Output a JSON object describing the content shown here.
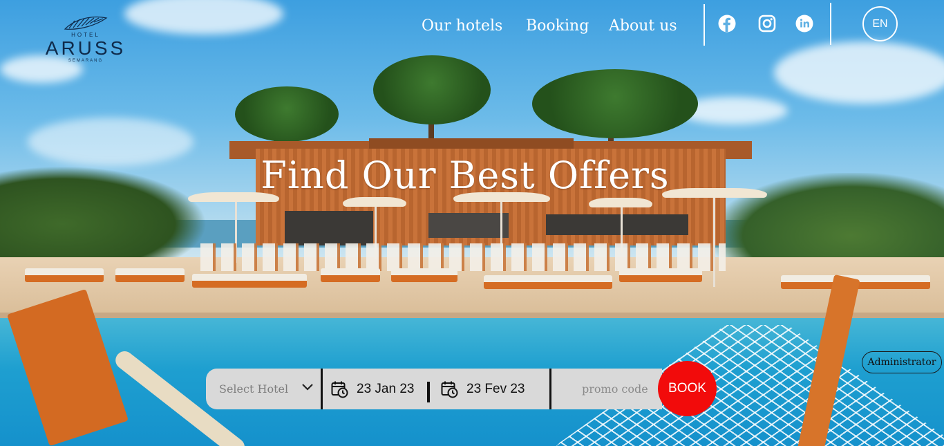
{
  "brand": {
    "small": "HOTEL",
    "name": "ARUSS",
    "sub": "SEMARANG",
    "logo_icon": "leaf-logo-icon",
    "color": "#0f2a4a"
  },
  "nav": {
    "items": [
      {
        "label": "Our hotels"
      },
      {
        "label": "Booking"
      },
      {
        "label": "About us"
      }
    ]
  },
  "social": [
    {
      "icon": "facebook-icon"
    },
    {
      "icon": "instagram-icon"
    },
    {
      "icon": "linkedin-icon"
    }
  ],
  "language": {
    "label": "EN"
  },
  "hero": {
    "title": "Find Our Best Offers"
  },
  "admin": {
    "label": "Administrator"
  },
  "booking": {
    "hotel_placeholder": "Select Hotel",
    "checkin": "23 Jan 23",
    "checkout": "23 Fev 23",
    "promo_placeholder": "promo code",
    "book_label": "BOOK",
    "bar_color": "#d9d9d9",
    "book_color": "#f20b0b"
  }
}
